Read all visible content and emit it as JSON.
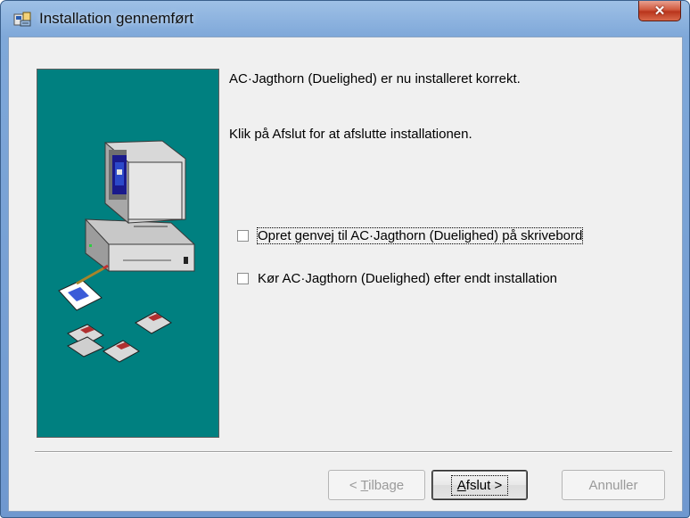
{
  "window": {
    "title": "Installation gennemført",
    "icon": "installer-icon",
    "close_glyph": "✕"
  },
  "messages": {
    "line1": "AC·Jagthorn (Duelighed) er nu installeret korrekt.",
    "line2": "Klik på Afslut for at afslutte installationen."
  },
  "options": [
    {
      "label": "Opret genvej til AC·Jagthorn (Duelighed) på skrivebord",
      "checked": false
    },
    {
      "label": "Kør AC·Jagthorn (Duelighed) efter endt installation",
      "checked": false
    }
  ],
  "buttons": {
    "back": {
      "pre": "< ",
      "key": "T",
      "post": "ilbage",
      "enabled": false
    },
    "finish": {
      "key": "A",
      "post": "fslut >",
      "enabled": true
    },
    "cancel": {
      "label": "Annuller",
      "enabled": false
    }
  },
  "colors": {
    "side_panel": "#008080",
    "title_bar": "#7fa8d9",
    "close_button": "#c8452a"
  },
  "side_panel_icons": [
    "computer-icon",
    "document-pen-icon",
    "floppy-disk-icon"
  ]
}
